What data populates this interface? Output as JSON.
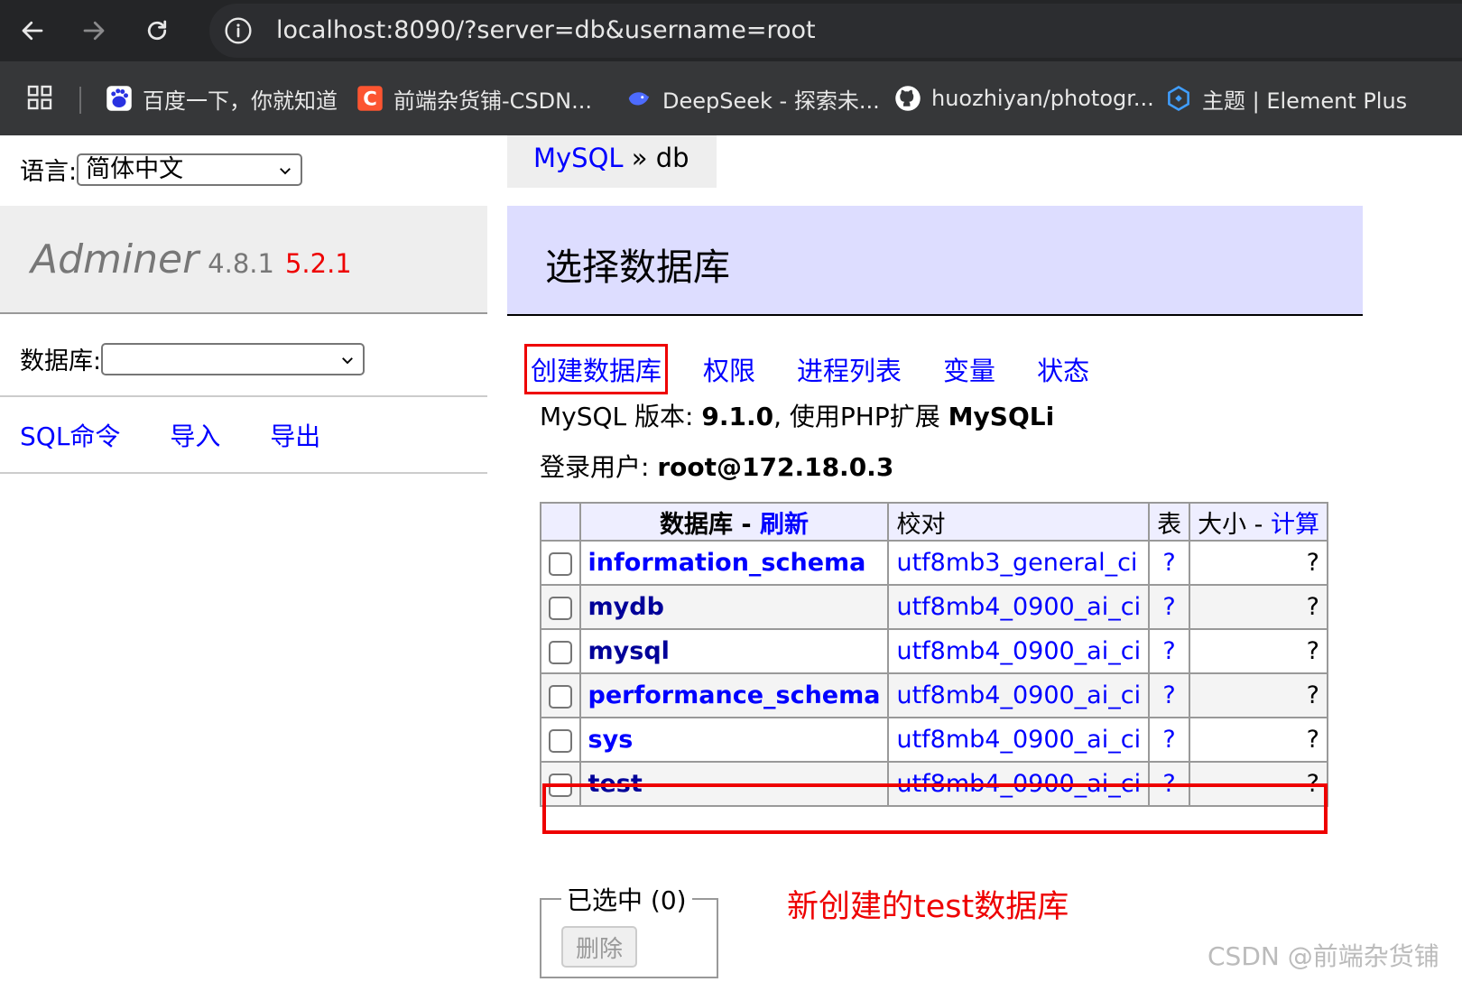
{
  "browser": {
    "url": "localhost:8090/?server=db&username=root",
    "bookmarks": [
      {
        "label": "百度一下，你就知道",
        "icon": "baidu-paw-icon"
      },
      {
        "label": "前端杂货铺-CSDN...",
        "icon": "csdn-logo-icon"
      },
      {
        "label": "DeepSeek - 探索未...",
        "icon": "deepseek-whale-icon"
      },
      {
        "label": "huozhiyan/photogr...",
        "icon": "github-icon"
      },
      {
        "label": "主题 | Element Plus",
        "icon": "element-plus-icon"
      }
    ]
  },
  "sidebar": {
    "language_label": "语言:",
    "language_value": "简体中文",
    "logo_name": "Adminer",
    "version": "4.8.1",
    "new_version": "5.2.1",
    "db_label": "数据库:",
    "db_value": "",
    "links": [
      "SQL命令",
      "导入",
      "导出"
    ]
  },
  "breadcrumb": {
    "driver": "MySQL",
    "separator": "»",
    "server": "db"
  },
  "main": {
    "title": "选择数据库",
    "menu": [
      "创建数据库",
      "权限",
      "进程列表",
      "变量",
      "状态"
    ],
    "version_label": "MySQL 版本:",
    "version_value": "9.1.0",
    "ext_label": ", 使用PHP扩展",
    "ext_value": "MySQLi",
    "login_label": "登录用户:",
    "login_value": "root@172.18.0.3"
  },
  "table": {
    "headers": {
      "database": "数据库",
      "dash": " - ",
      "refresh": "刷新",
      "collation": "校对",
      "tables": "表",
      "size": "大小",
      "compute": "计算"
    },
    "rows": [
      {
        "name": "information_schema",
        "collation": "utf8mb3_general_ci",
        "tables": "?",
        "size": "?"
      },
      {
        "name": "mydb",
        "collation": "utf8mb4_0900_ai_ci",
        "tables": "?",
        "size": "?"
      },
      {
        "name": "mysql",
        "collation": "utf8mb4_0900_ai_ci",
        "tables": "?",
        "size": "?"
      },
      {
        "name": "performance_schema",
        "collation": "utf8mb4_0900_ai_ci",
        "tables": "?",
        "size": "?"
      },
      {
        "name": "sys",
        "collation": "utf8mb4_0900_ai_ci",
        "tables": "?",
        "size": "?"
      },
      {
        "name": "test",
        "collation": "utf8mb4_0900_ai_ci",
        "tables": "?",
        "size": "?"
      }
    ]
  },
  "selection": {
    "legend": "已选中 (0)",
    "delete_label": "删除"
  },
  "annotation": "新创建的test数据库",
  "watermark": "CSDN @前端杂货铺",
  "colors": {
    "link": "#0000ff",
    "highlight": "#ee0000",
    "header_bg": "#ddddff"
  }
}
